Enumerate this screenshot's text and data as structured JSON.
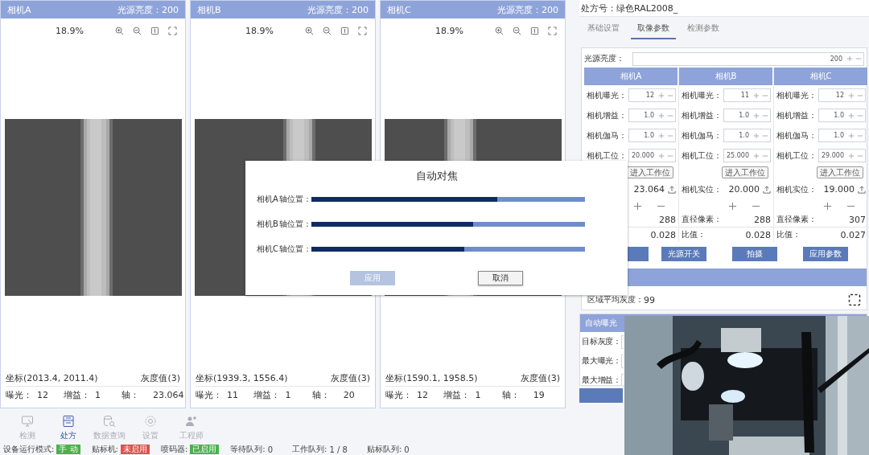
{
  "cameras": [
    {
      "title": "相机A",
      "brightness": "光源亮度：200",
      "zoom": "18.9%",
      "coords": "坐标(2013.4, 2011.4)",
      "gray": "灰度值(3)",
      "exposure_label": "曝光：",
      "exposure": "12",
      "gain_label": "增益：",
      "gain": "1",
      "axis_label": "轴：",
      "axis": "23.064"
    },
    {
      "title": "相机B",
      "brightness": "光源亮度：200",
      "zoom": "18.9%",
      "coords": "坐标(1939.3, 1556.4)",
      "gray": "灰度值(3)",
      "exposure_label": "曝光：",
      "exposure": "11",
      "gain_label": "增益：",
      "gain": "1",
      "axis_label": "轴：",
      "axis": "20"
    },
    {
      "title": "相机C",
      "brightness": "光源亮度：200",
      "zoom": "18.9%",
      "coords": "坐标(1590.1, 1958.5)",
      "gray": "灰度值(3)",
      "exposure_label": "曝光：",
      "exposure": "12",
      "gain_label": "增益：",
      "gain": "1",
      "axis_label": "轴：",
      "axis": "19"
    }
  ],
  "nav": [
    {
      "label": "检测",
      "kind": "monitor",
      "selected": false
    },
    {
      "label": "处方",
      "kind": "recipe",
      "selected": true
    },
    {
      "label": "数据查询",
      "kind": "query",
      "selected": false
    },
    {
      "label": "设置",
      "kind": "settings",
      "selected": false
    },
    {
      "label": "工程师",
      "kind": "engineer",
      "selected": false
    }
  ],
  "status_bar": [
    {
      "kind": "badge",
      "label": "设备运行模式:",
      "value": "手 动",
      "color": "#4caf50"
    },
    {
      "kind": "badge",
      "label": "贴标机:",
      "value": "未启用",
      "color": "#d9534f"
    },
    {
      "kind": "badge",
      "label": "喷码器:",
      "value": "已启用",
      "color": "#4caf50"
    },
    {
      "kind": "count",
      "label": "等待队列:",
      "value": "0"
    },
    {
      "kind": "count",
      "label": "工作队列:",
      "value": "1 / 8"
    },
    {
      "kind": "count",
      "label": "贴标队列:",
      "value": "0"
    }
  ],
  "recipe": {
    "label": "处方号：",
    "value": "绿色RAL2008_"
  },
  "tabs": [
    {
      "label": "基础设置",
      "selected": false
    },
    {
      "label": "取像参数",
      "selected": true
    },
    {
      "label": "检测参数",
      "selected": false
    }
  ],
  "light_source": {
    "label": "光源亮度：",
    "value": "200"
  },
  "param_columns": [
    {
      "header": "相机A",
      "fields": [
        {
          "label": "相机曝光：",
          "value": "12"
        },
        {
          "label": "相机增益：",
          "value": "1.0"
        },
        {
          "label": "相机伽马：",
          "value": "1.0"
        },
        {
          "label": "相机工位：",
          "value": "20.000"
        }
      ],
      "enter_button": "进入工作位",
      "actual": "23.064",
      "diameter": "288",
      "ratio": "0.028"
    },
    {
      "header": "相机B",
      "fields": [
        {
          "label": "相机曝光：",
          "value": "11"
        },
        {
          "label": "相机增益：",
          "value": "1.0"
        },
        {
          "label": "相机伽马：",
          "value": "1.0"
        },
        {
          "label": "相机工位：",
          "value": "25.000"
        }
      ],
      "enter_button": "进入工作位",
      "actual_label": "相机实位：",
      "actual": "20.000",
      "diameter_label": "直径像素：",
      "diameter": "288",
      "ratio_label": "比值：",
      "ratio": "0.028"
    },
    {
      "header": "相机C",
      "fields": [
        {
          "label": "相机曝光：",
          "value": "12"
        },
        {
          "label": "相机增益：",
          "value": "1.0"
        },
        {
          "label": "相机伽马：",
          "value": "1.0"
        },
        {
          "label": "相机工位：",
          "value": "29.000"
        }
      ],
      "enter_button": "进入工作位",
      "actual_label": "相机实位：",
      "actual": "19.000",
      "diameter_label": "直径像素：",
      "diameter": "307",
      "ratio_label": "比值：",
      "ratio": "0.027"
    }
  ],
  "actions": [
    "光源开关",
    "拍摄",
    "应用参数"
  ],
  "region_gray": {
    "label": "区域平均灰度：",
    "value": "99"
  },
  "auto_exposure": {
    "title": "自动曝光",
    "fields": [
      "目标灰度：",
      "最大曝光：",
      "最大增益："
    ]
  },
  "dialog": {
    "title": "自动对焦",
    "rows": [
      {
        "camera": "相机A",
        "label": "轴位置：",
        "level": 0.68
      },
      {
        "camera": "相机B",
        "label": "轴位置：",
        "level": 0.59
      },
      {
        "camera": "相机C",
        "label": "轴位置：",
        "level": 0.56
      }
    ],
    "buttons": [
      {
        "label": "应用",
        "disabled": true
      },
      {
        "label": "取消",
        "disabled": false
      }
    ]
  },
  "video": {
    "kind": "picture"
  }
}
